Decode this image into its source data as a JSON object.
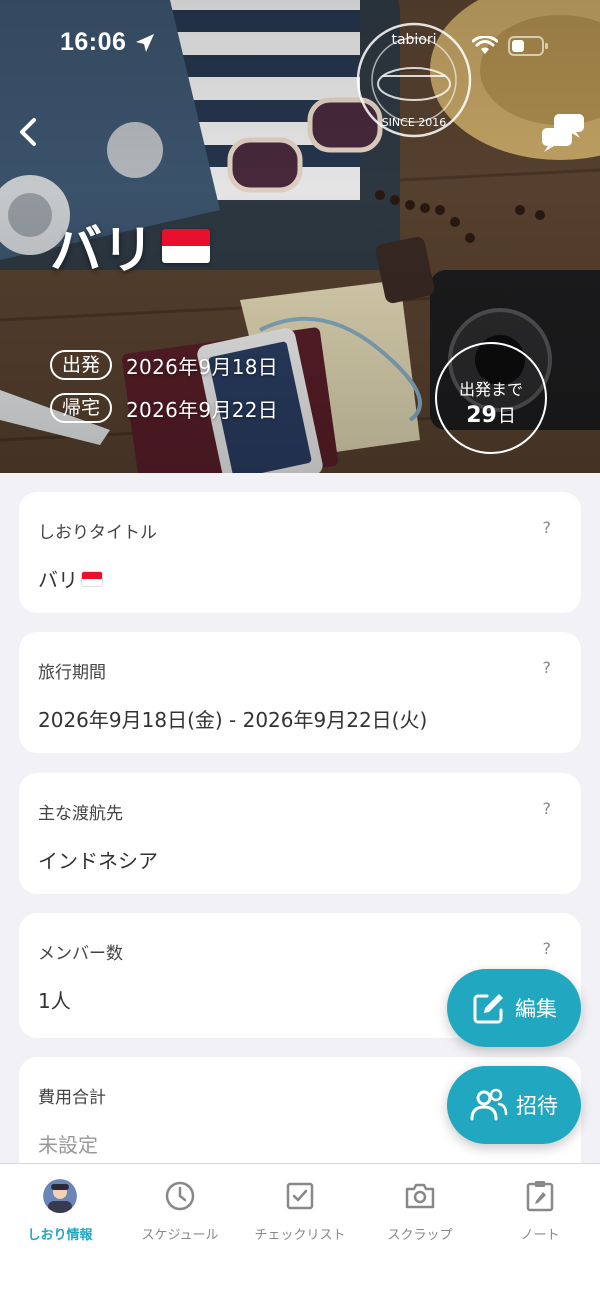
{
  "status_bar": {
    "time": "16:06"
  },
  "hero": {
    "title": "バリ",
    "stamp_text": "tabiori",
    "stamp_since": "SINCE 2016",
    "departure_label": "出発",
    "departure_date": "2026年9月18日",
    "return_label": "帰宅",
    "return_date": "2026年9月22日",
    "countdown_label": "出発まで",
    "countdown_value": "29",
    "countdown_unit": "日"
  },
  "cards": [
    {
      "label": "しおりタイトル",
      "help": "?",
      "value": "バリ"
    },
    {
      "label": "旅行期間",
      "help": "?",
      "value": "2026年9月18日(金) - 2026年9月22日(火)"
    },
    {
      "label": "主な渡航先",
      "help": "?",
      "value": "インドネシア"
    },
    {
      "label": "メンバー数",
      "help": "?",
      "value": "1人"
    },
    {
      "label": "費用合計",
      "help": "?",
      "value": "未設定"
    }
  ],
  "fabs": {
    "edit": "編集",
    "invite": "招待"
  },
  "tabs": [
    {
      "label": "しおり情報",
      "icon": "avatar"
    },
    {
      "label": "スケジュール",
      "icon": "clock-icon"
    },
    {
      "label": "チェックリスト",
      "icon": "checkbox-icon"
    },
    {
      "label": "スクラップ",
      "icon": "camera-icon"
    },
    {
      "label": "ノート",
      "icon": "note-icon"
    }
  ],
  "colors": {
    "accent": "#21a8c0",
    "flag_red": "#e8112d"
  }
}
